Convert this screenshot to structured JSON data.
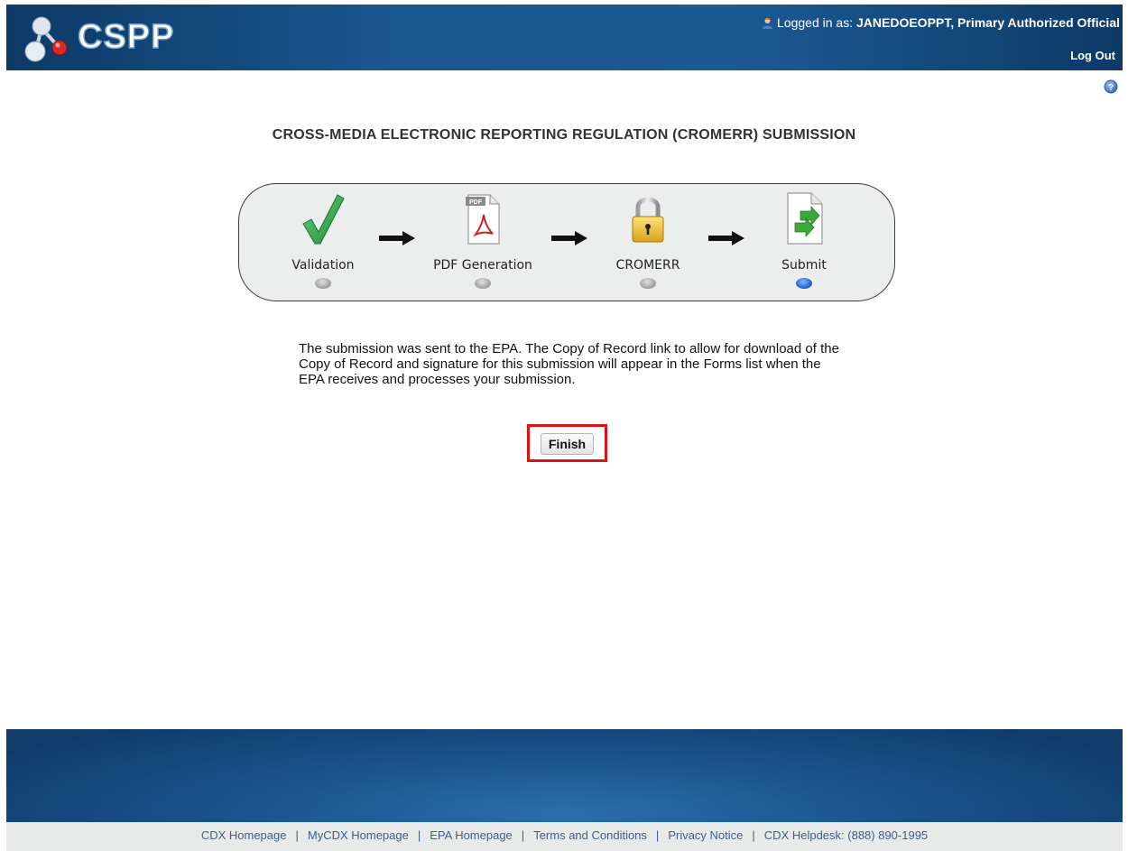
{
  "header": {
    "app_name": "CSPP",
    "logged_in_prefix": "Logged in as: ",
    "user_name": "JANEDOEOPPT",
    "user_role": ", Primary Authorized Official",
    "logout_label": "Log Out",
    "user_icon": "user-icon",
    "help_icon": "help-icon"
  },
  "page": {
    "title": "CROSS-MEDIA ELECTRONIC REPORTING REGULATION (CROMERR) SUBMISSION"
  },
  "wizard": {
    "steps": [
      {
        "label": "Validation",
        "icon": "checkmark-icon",
        "active": false
      },
      {
        "label": "PDF Generation",
        "icon": "pdf-icon",
        "active": false
      },
      {
        "label": "CROMERR",
        "icon": "lock-icon",
        "active": false
      },
      {
        "label": "Submit",
        "icon": "submit-document-icon",
        "active": true
      }
    ]
  },
  "message": {
    "text": "The submission was sent to the EPA. The Copy of Record link to allow for download of the Copy of Record and signature for this submission will appear in the Forms list when the EPA receives and processes your submission."
  },
  "actions": {
    "finish_label": "Finish"
  },
  "footer": {
    "links": [
      "CDX Homepage",
      "MyCDX Homepage",
      "EPA Homepage",
      "Terms and Conditions",
      "Privacy Notice",
      "CDX Helpdesk: (888) 890-1995"
    ],
    "separator": "|"
  },
  "colors": {
    "header_bg": "#1a5690",
    "active_step": "#2d6fd6",
    "highlight_border": "#e01010"
  }
}
